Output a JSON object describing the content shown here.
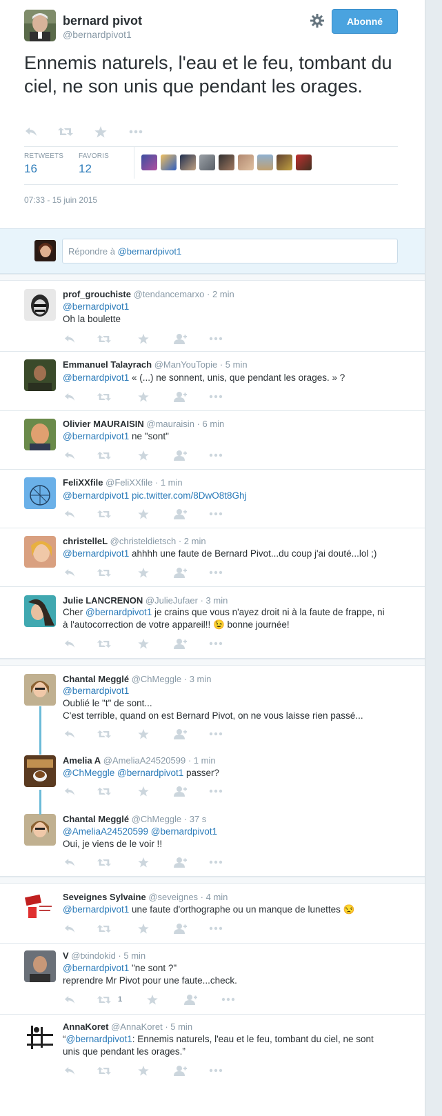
{
  "main_tweet": {
    "name": "bernard pivot",
    "handle": "@bernardpivot1",
    "follow_label": "Abonné",
    "text": "Ennemis naturels, l'eau et le feu, tombant du ciel, ne son unis que pendant les orages.",
    "retweets_label": "RETWEETS",
    "retweets_count": "16",
    "favorites_label": "FAVORIS",
    "favorites_count": "12",
    "timestamp": "07:33 - 15 juin 2015"
  },
  "reply_box": {
    "prefix": "Répondre à ",
    "mention": "@bernardpivot1"
  },
  "replies": [
    {
      "name": "prof_grouchiste",
      "meta": "@tendancemarxo · 2 min",
      "lines": [
        [
          "@bernardpivot1",
          ""
        ],
        [
          "",
          "Oh la boulette"
        ]
      ]
    },
    {
      "name": "Emmanuel Talayrach",
      "meta": "@ManYouTopie · 5 min",
      "lines": [
        [
          "@bernardpivot1",
          " « (...) ne sonnent, unis, que pendant les orages. » ?"
        ]
      ]
    },
    {
      "name": "Olivier MAURAISIN",
      "meta": "@mauraisin · 6 min",
      "lines": [
        [
          "@bernardpivot1",
          " ne \"sont\""
        ]
      ]
    },
    {
      "name": "FeliXXfile",
      "meta": "@FeliXXfile · 1 min",
      "lines": [
        [
          "@bernardpivot1 pic.twitter.com/8DwO8t8Ghj",
          ""
        ]
      ]
    },
    {
      "name": "christelleL",
      "meta": "@christeldietsch · 2 min",
      "lines": [
        [
          "@bernardpivot1",
          " ahhhh une faute de Bernard Pivot...du coup j'ai douté...lol ;)"
        ]
      ]
    },
    {
      "name": "Julie LANCRENON",
      "meta": "@JulieJufaer · 3 min",
      "lines": [
        [
          "",
          "Cher "
        ],
        [
          "@bernardpivot1",
          " je crains que vous n'ayez droit ni à la faute de frappe, ni"
        ],
        [
          "",
          "à l'autocorrection de votre appareil!! 😉 bonne journée!"
        ]
      ]
    },
    {
      "name": "Chantal Megglé",
      "meta": "@ChMeggle · 3 min",
      "lines": [
        [
          "@bernardpivot1",
          ""
        ],
        [
          "",
          "Oublié le \"t\" de sont..."
        ],
        [
          "",
          "C'est terrible, quand on est Bernard Pivot, on ne vous laisse rien passé..."
        ]
      ]
    },
    {
      "name": "Amelia A",
      "meta": "@AmeliaA24520599 · 1 min",
      "lines": [
        [
          "@ChMeggle @bernardpivot1",
          " passer?"
        ]
      ]
    },
    {
      "name": "Chantal Megglé",
      "meta": "@ChMeggle · 37 s",
      "lines": [
        [
          "@AmeliaA24520599 @bernardpivot1",
          ""
        ],
        [
          "",
          "Oui, je viens de le voir !!"
        ]
      ]
    },
    {
      "name": "Seveignes Sylvaine",
      "meta": "@seveignes · 4 min",
      "lines": [
        [
          "@bernardpivot1",
          " une faute d'orthographe ou un manque de lunettes 😒"
        ]
      ]
    },
    {
      "name": "V",
      "meta": "@txindokid · 5 min",
      "retweet_count": "1",
      "lines": [
        [
          "@bernardpivot1",
          " \"ne sont ?\""
        ],
        [
          "",
          "reprendre Mr Pivot pour une faute...check."
        ]
      ]
    },
    {
      "name": "AnnaKoret",
      "meta": "@AnnaKoret · 5 min",
      "lines": [
        [
          "",
          "“"
        ],
        [
          "@bernardpivot1",
          ": Ennemis naturels, l'eau et le feu, tombant du ciel, ne sont"
        ],
        [
          "",
          "unis que pendant les orages.”"
        ]
      ]
    }
  ],
  "colors": {
    "link": "#2b7bb9",
    "follow_button": "#4aa3df",
    "thread_line": "#6bbad8",
    "muted": "#8899a6"
  },
  "icons": [
    "gear-icon",
    "reply-icon",
    "retweet-icon",
    "favorite-icon",
    "follow-icon",
    "more-icon"
  ]
}
